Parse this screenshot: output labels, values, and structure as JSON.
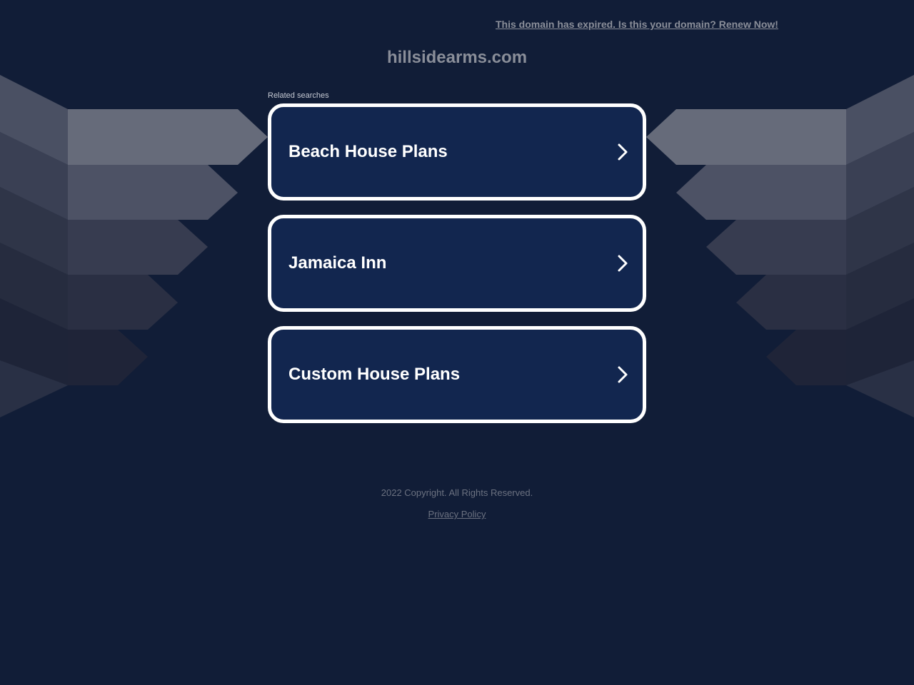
{
  "header": {
    "expired_notice": "This domain has expired. Is this your domain? Renew Now!",
    "domain": "hillsidearms.com"
  },
  "related": {
    "label": "Related searches",
    "items": [
      {
        "label": "Beach House Plans",
        "icon": "chevron-right-icon"
      },
      {
        "label": "Jamaica Inn",
        "icon": "chevron-right-icon"
      },
      {
        "label": "Custom House Plans",
        "icon": "chevron-right-icon"
      }
    ]
  },
  "footer": {
    "copyright": "2022 Copyright. All Rights Reserved.",
    "privacy_label": "Privacy Policy"
  },
  "colors": {
    "background": "#111d37",
    "card_fill": "#12264f",
    "card_border": "#ffffff",
    "muted_text": "#8a8e99"
  }
}
